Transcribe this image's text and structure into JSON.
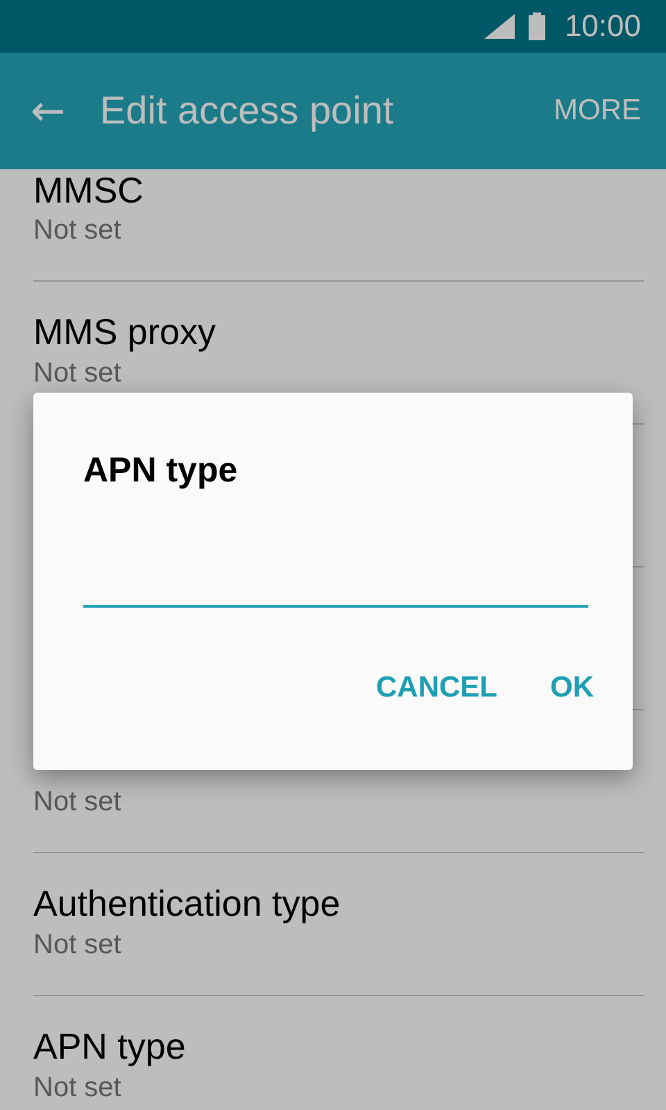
{
  "status_bar": {
    "time": "10:00"
  },
  "app_bar": {
    "back": "←",
    "title": "Edit access point",
    "action": "MORE"
  },
  "settings_above": [
    {
      "title": "MMSC",
      "subtitle": "Not set"
    },
    {
      "title": "MMS proxy",
      "subtitle": "Not set"
    }
  ],
  "settings_below": [
    {
      "subtitle": "Not set"
    },
    {
      "title": "Authentication type",
      "subtitle": "Not set"
    },
    {
      "title": "APN type",
      "subtitle": "Not set"
    }
  ],
  "dialog": {
    "title": "APN type",
    "buttons": [
      "CANCEL",
      "OK"
    ]
  }
}
